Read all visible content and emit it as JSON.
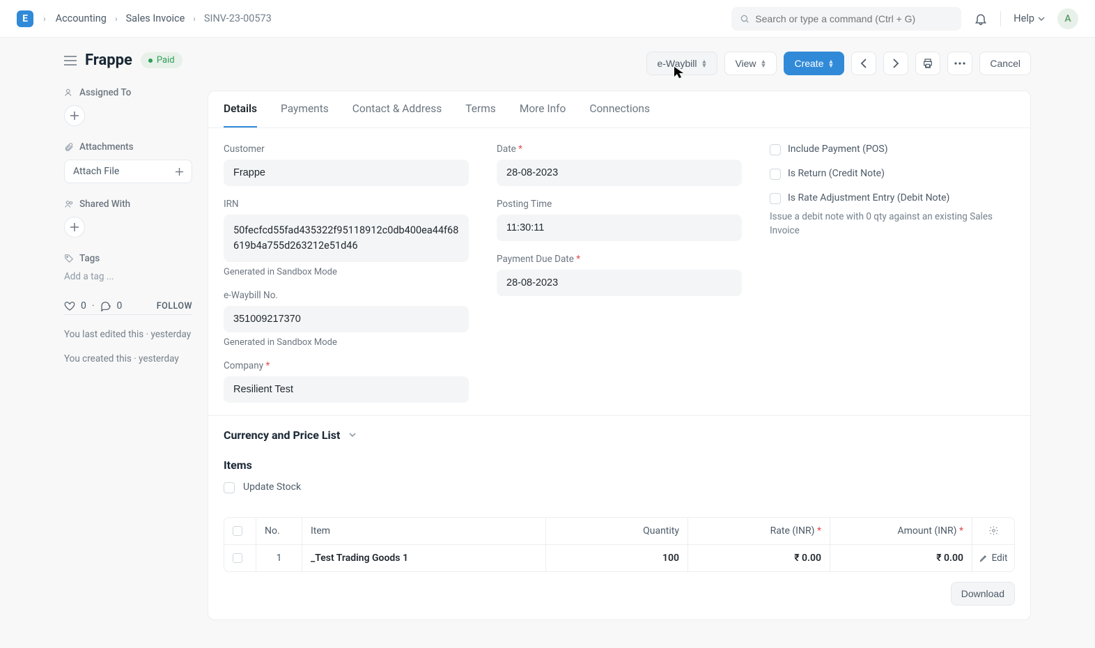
{
  "navbar": {
    "logo_letter": "E",
    "breadcrumbs": [
      "Accounting",
      "Sales Invoice",
      "SINV-23-00573"
    ],
    "search_placeholder": "Search or type a command (Ctrl + G)",
    "help_label": "Help",
    "avatar_letter": "A"
  },
  "header": {
    "title": "Frappe",
    "status": "Paid"
  },
  "sidebar": {
    "assigned_to_label": "Assigned To",
    "attachments_label": "Attachments",
    "attach_file_label": "Attach File",
    "shared_with_label": "Shared With",
    "tags_label": "Tags",
    "tag_placeholder": "Add a tag ...",
    "like_count": "0",
    "comment_count": "0",
    "follow_label": "FOLLOW",
    "edited_text": "You last edited this · yesterday",
    "created_text": "You created this · yesterday"
  },
  "toolbar": {
    "ewaybill_label": "e-Waybill",
    "view_label": "View",
    "create_label": "Create",
    "cancel_label": "Cancel"
  },
  "tabs": [
    "Details",
    "Payments",
    "Contact & Address",
    "Terms",
    "More Info",
    "Connections"
  ],
  "form": {
    "customer_label": "Customer",
    "customer_value": "Frappe",
    "irn_label": "IRN",
    "irn_value": "50fecfcd55fad435322f95118912c0db400ea44f68619b4a755d263212e51d46",
    "irn_help": "Generated in Sandbox Mode",
    "ewaybill_no_label": "e-Waybill No.",
    "ewaybill_no_value": "351009217370",
    "ewaybill_no_help": "Generated in Sandbox Mode",
    "company_label": "Company",
    "company_value": "Resilient Test",
    "date_label": "Date",
    "date_value": "28-08-2023",
    "posting_time_label": "Posting Time",
    "posting_time_value": "11:30:11",
    "payment_due_label": "Payment Due Date",
    "payment_due_value": "28-08-2023",
    "include_payment_label": "Include Payment (POS)",
    "is_return_label": "Is Return (Credit Note)",
    "is_rate_adj_label": "Is Rate Adjustment Entry (Debit Note)",
    "rate_adj_help": "Issue a debit note with 0 qty against an existing Sales Invoice"
  },
  "sections": {
    "currency_label": "Currency and Price List",
    "items_label": "Items",
    "update_stock_label": "Update Stock"
  },
  "items_table": {
    "headers": {
      "no": "No.",
      "item": "Item",
      "qty": "Quantity",
      "rate": "Rate (INR)",
      "amount": "Amount (INR)"
    },
    "rows": [
      {
        "no": "1",
        "item": "_Test Trading Goods 1",
        "qty": "100",
        "rate": "₹ 0.00",
        "amount": "₹ 0.00"
      }
    ],
    "edit_label": "Edit",
    "download_label": "Download"
  }
}
